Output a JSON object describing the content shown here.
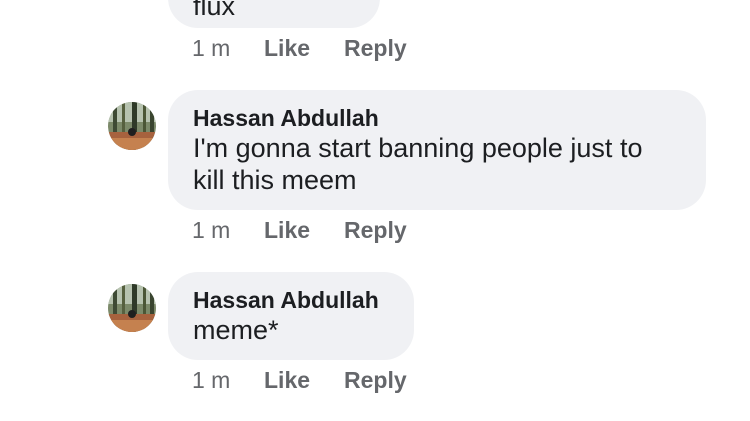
{
  "prev_comment": {
    "text_fragment": "flux",
    "actions": {
      "time": "1 m",
      "like": "Like",
      "reply": "Reply"
    }
  },
  "comments": [
    {
      "author": "Hassan Abdullah",
      "text_line1": "I'm gonna start banning people just to",
      "text_line2": "kill this meem",
      "actions": {
        "time": "1 m",
        "like": "Like",
        "reply": "Reply"
      }
    },
    {
      "author": "Hassan Abdullah",
      "text_line1": "meme*",
      "actions": {
        "time": "1 m",
        "like": "Like",
        "reply": "Reply"
      }
    }
  ],
  "colors": {
    "bubble": "#f0f1f4",
    "text": "#1c1e21",
    "meta": "#65676b"
  },
  "icons": {
    "avatar": "forest-photo-avatar"
  }
}
